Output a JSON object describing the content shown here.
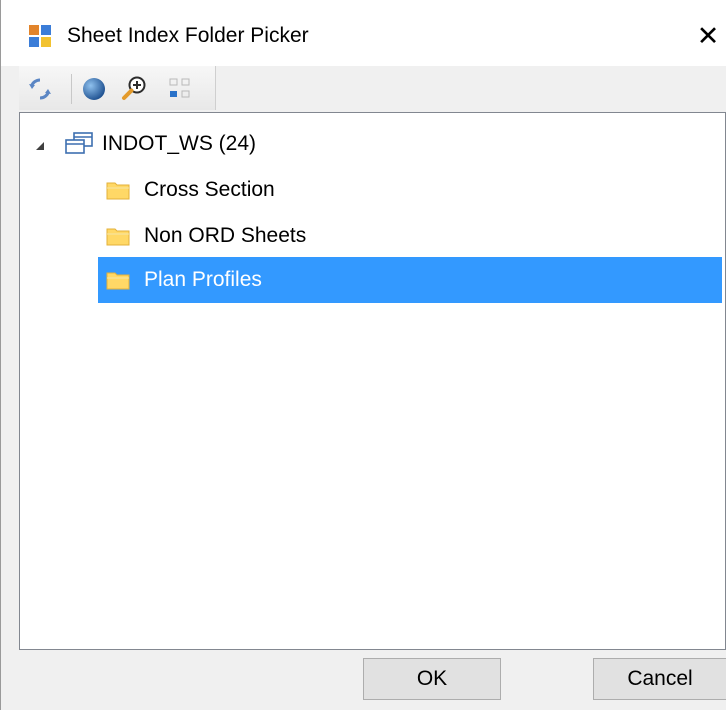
{
  "window": {
    "title": "Sheet Index Folder Picker",
    "close_glyph": "✕"
  },
  "toolbar": {
    "buttons": [
      {
        "icon": "refresh-icon"
      },
      {
        "icon": "globe-icon"
      },
      {
        "icon": "zoom-in-icon"
      },
      {
        "icon": "grid-view-icon"
      }
    ]
  },
  "tree": {
    "root": {
      "label": "INDOT_WS (24)",
      "icon": "datasource-icon",
      "expanded": true
    },
    "children": [
      {
        "label": "Cross Section",
        "icon": "folder-icon",
        "selected": false
      },
      {
        "label": "Non ORD Sheets",
        "icon": "folder-icon",
        "selected": false
      },
      {
        "label": "Plan Profiles",
        "icon": "folder-icon",
        "selected": true
      }
    ]
  },
  "buttons": {
    "ok_label": "OK",
    "cancel_label": "Cancel"
  },
  "colors": {
    "selection": "#3399ff",
    "folder": "#ffd866",
    "titlebar": "#ffffff",
    "dialog_bg": "#f0f0f0"
  }
}
